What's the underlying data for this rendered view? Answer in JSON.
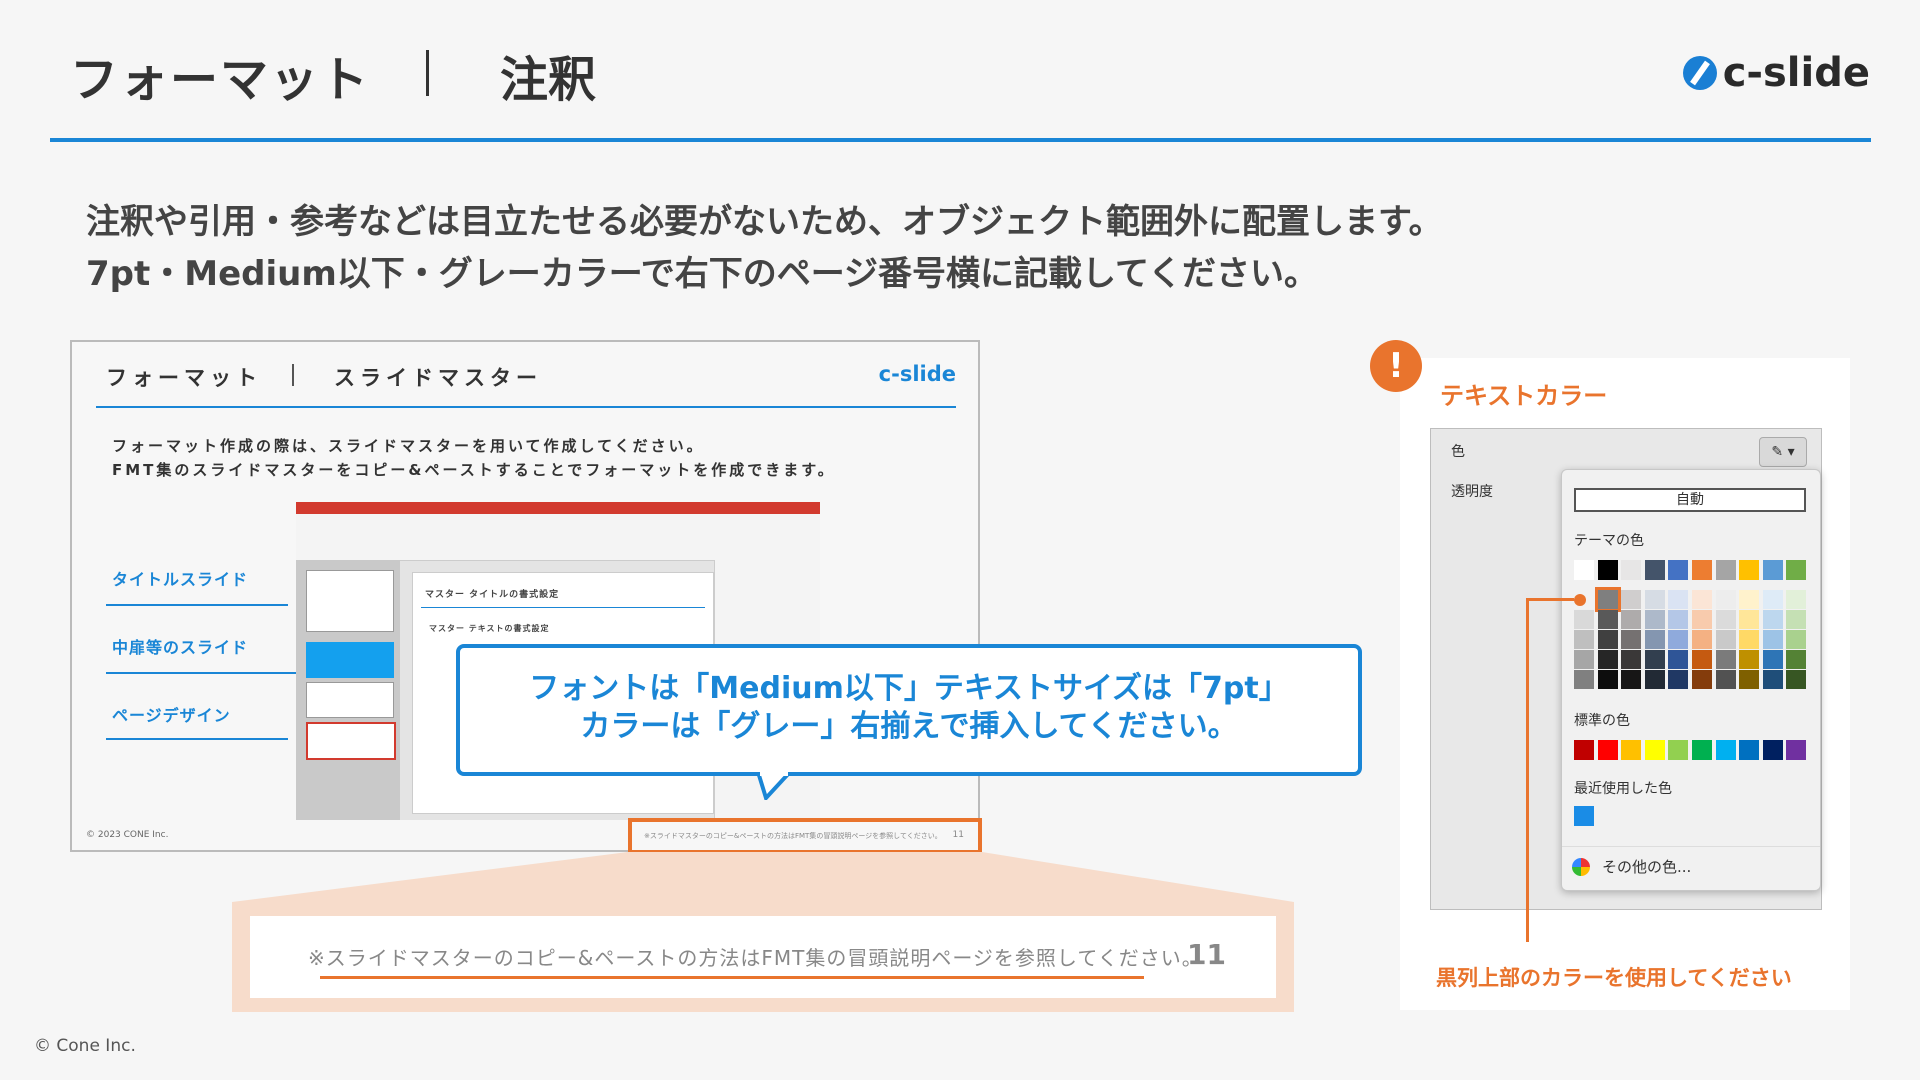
{
  "header": {
    "title": "フォーマット",
    "subtitle": "注釈",
    "brand": "c-slide"
  },
  "lead": {
    "line1": "注釈や引用・参考などは目立たせる必要がないため、オブジェクト範囲外に配置します。",
    "line2": "7pt・Medium以下・グレーカラーで右下のページ番号横に記載してください。"
  },
  "slide": {
    "title": "フォーマット",
    "subtitle": "スライドマスター",
    "brand": "c-slide",
    "lead1": "フォーマット作成の際は、スライドマスターを用いて作成してください。",
    "lead2": "FMT集のスライドマスターをコピー&ペーストすることでフォーマットを作成できます。",
    "labels": [
      "タイトルスライド",
      "中扉等のスライド",
      "ページデザイン"
    ],
    "copyright": "© 2023 CONE Inc.",
    "app": {
      "master_title": "マスター タイトルの書式設定",
      "master_text": "マスター テキストの書式設定"
    },
    "note": "※スライドマスターのコピー&ペーストの方法はFMT集の冒頭説明ページを参照してください。",
    "page_number": "11"
  },
  "callout": {
    "line1": "フォントは「Medium以下」テキストサイズは「7pt」",
    "line2": "カラーは「グレー」右揃えで挿入してください。"
  },
  "zoom": {
    "note": "※スライドマスターのコピー&ペーストの方法はFMT集の冒頭説明ページを参照してください。",
    "page_number": "11"
  },
  "color_panel": {
    "title": "テキストカラー",
    "color_label": "色",
    "opacity_label": "透明度",
    "auto_label": "自動",
    "theme_label": "テーマの色",
    "standard_label": "標準の色",
    "recent_label": "最近使用した色",
    "more_label": "その他の色...",
    "footer": "黒列上部のカラーを使用してください",
    "theme_top": [
      "#ffffff",
      "#000000",
      "#e7e6e6",
      "#44546a",
      "#4472c4",
      "#ed7d31",
      "#a5a5a5",
      "#ffc000",
      "#5b9bd5",
      "#70ad47"
    ],
    "theme_cols": [
      [
        "#f2f2f2",
        "#d9d9d9",
        "#bfbfbf",
        "#a6a6a6",
        "#808080"
      ],
      [
        "#7f7f7f",
        "#595959",
        "#404040",
        "#262626",
        "#0d0d0d"
      ],
      [
        "#d0cece",
        "#aeabab",
        "#757171",
        "#3a3838",
        "#171616"
      ],
      [
        "#d6dce4",
        "#adb9ca",
        "#8496b0",
        "#323f4f",
        "#222a35"
      ],
      [
        "#dae3f3",
        "#b4c7e7",
        "#8faadc",
        "#2f5597",
        "#203864"
      ],
      [
        "#fbe5d6",
        "#f8cbad",
        "#f4b183",
        "#c55a11",
        "#843c0c"
      ],
      [
        "#ededed",
        "#dbdbdb",
        "#c9c9c9",
        "#7b7b7b",
        "#525252"
      ],
      [
        "#fff2cc",
        "#ffe699",
        "#ffd966",
        "#bf9000",
        "#7f6000"
      ],
      [
        "#deebf7",
        "#bdd7ee",
        "#9dc3e6",
        "#2e75b6",
        "#1f4e79"
      ],
      [
        "#e2f0d9",
        "#c5e0b4",
        "#a9d18e",
        "#548235",
        "#375623"
      ]
    ],
    "standard": [
      "#c00000",
      "#ff0000",
      "#ffc000",
      "#ffff00",
      "#92d050",
      "#00b050",
      "#00b0f0",
      "#0070c0",
      "#002060",
      "#7030a0"
    ],
    "recent_color": "#1a8ce6"
  },
  "footer": {
    "copyright": "© Cone Inc."
  }
}
